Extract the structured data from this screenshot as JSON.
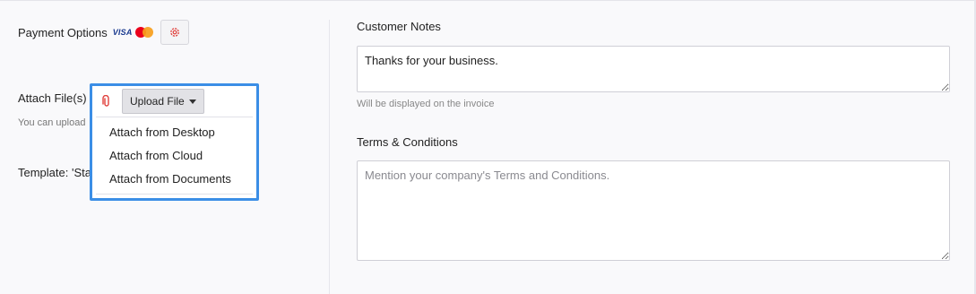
{
  "payment": {
    "label": "Payment Options",
    "card_logos": [
      "visa",
      "mastercard"
    ],
    "visa_text": "VISA",
    "settings_icon": "gear-icon"
  },
  "attachments": {
    "label": "Attach File(s)",
    "hint": "You can upload",
    "upload_button_label": "Upload File",
    "clip_icon": "paperclip-icon",
    "menu_items": [
      "Attach from Desktop",
      "Attach from Cloud",
      "Attach from Documents"
    ]
  },
  "template": {
    "label": "Template: 'Sta"
  },
  "customer_notes": {
    "label": "Customer Notes",
    "value": "Thanks for your business.",
    "hint": "Will be displayed on the invoice"
  },
  "terms": {
    "label": "Terms & Conditions",
    "placeholder": "Mention your company's Terms and Conditions."
  },
  "colors": {
    "highlight": "#3b8ee6",
    "clip_icon": "#e0403c",
    "gear_icon": "#e0403c"
  }
}
